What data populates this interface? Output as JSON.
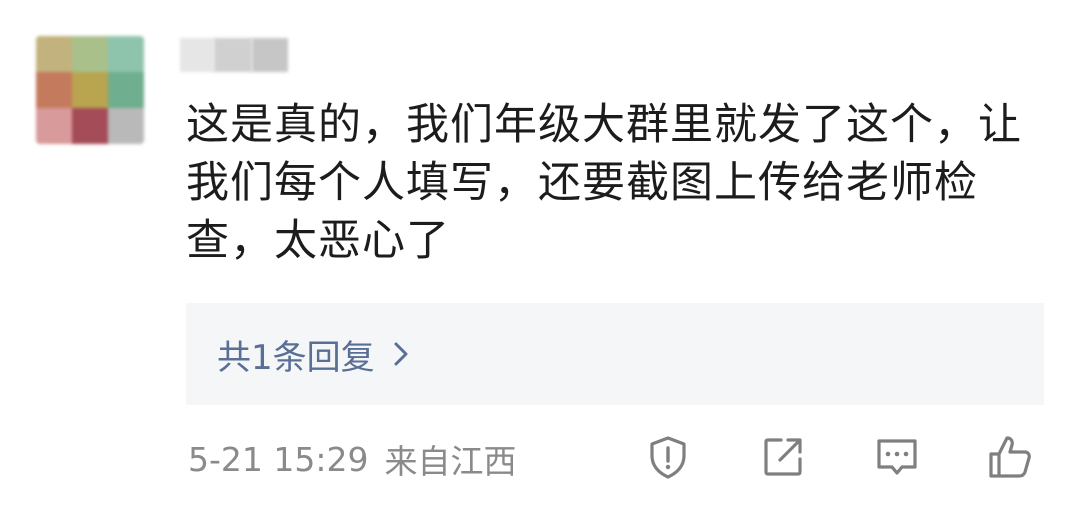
{
  "comment": {
    "avatar_label": "avatar",
    "username_label": "username",
    "text": "这是真的，我们年级大群里就发了这个，让我们每个人填写，还要截图上传给老师检查，太恶心了",
    "reply": {
      "label": "共1条回复"
    },
    "meta": {
      "time": "5-21 15:29",
      "location": "来自江西"
    },
    "actions": [
      {
        "icon": "shield-icon"
      },
      {
        "icon": "share-icon"
      },
      {
        "icon": "comment-icon"
      },
      {
        "icon": "like-icon"
      }
    ]
  },
  "colors": {
    "text": "#1c1c1c",
    "link": "#5a6f96",
    "meta": "#8a8a8a",
    "reply_bg": "#f5f6f8",
    "icon": "#7f7f7f"
  }
}
